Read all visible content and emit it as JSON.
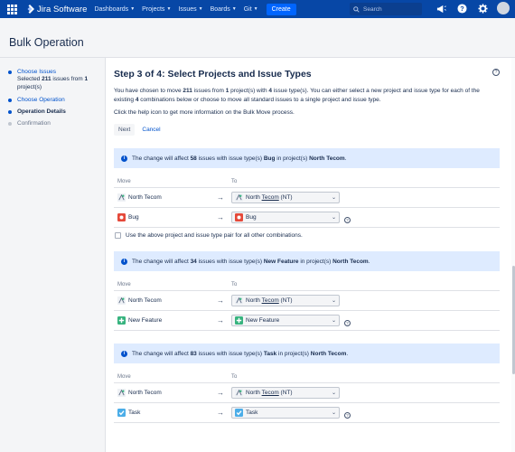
{
  "nav": {
    "product": "Jira Software",
    "menu": [
      "Dashboards",
      "Projects",
      "Issues",
      "Boards",
      "Git"
    ],
    "create_label": "Create",
    "search_placeholder": "Search"
  },
  "page": {
    "title": "Bulk Operation"
  },
  "sidebar": {
    "steps": [
      {
        "label": "Choose Issues",
        "detail_prefix": "Selected ",
        "detail_count": "211",
        "detail_mid": " issues from ",
        "detail_projects": "1",
        "detail_suffix": " project(s)"
      },
      {
        "label": "Choose Operation"
      },
      {
        "label": "Operation Details"
      },
      {
        "label": "Confirmation"
      }
    ]
  },
  "main": {
    "heading": "Step 3 of 4: Select Projects and Issue Types",
    "desc1_a": "You have chosen to move ",
    "desc1_count": "211",
    "desc1_b": " issues from ",
    "desc1_projects": "1",
    "desc1_c": " project(s) with ",
    "desc1_types": "4",
    "desc1_d": " issue type(s). You can either select a new project and issue type for each of the existing ",
    "desc1_combos": "4",
    "desc1_e": " combinations below or choose to move all standard issues to a single project and issue type.",
    "desc2": "Click the help icon to get more information on the Bulk Move process.",
    "next_label": "Next",
    "cancel_label": "Cancel",
    "col_move": "Move",
    "col_to": "To",
    "checkbox_label": "Use the above project and issue type pair for all other combinations.",
    "info_a": "The change will affect ",
    "info_b": " issues with issue type(s) ",
    "info_c": " in project(s) ",
    "groups": [
      {
        "count": "58",
        "type": "Bug",
        "project": "North Tecom",
        "from_project": "North Tecom",
        "to_project_a": "North ",
        "to_project_u": "Tecom",
        "to_project_b": " (NT)",
        "from_type": "Bug",
        "to_type": "Bug"
      },
      {
        "count": "34",
        "type": "New Feature",
        "project": "North Tecom",
        "from_project": "North Tecom",
        "to_project_a": "North ",
        "to_project_u": "Tecom",
        "to_project_b": " (NT)",
        "from_type": "New Feature",
        "to_type": "New Feature"
      },
      {
        "count": "83",
        "type": "Task",
        "project": "North Tecom",
        "from_project": "North Tecom",
        "to_project_a": "North ",
        "to_project_u": "Tecom",
        "to_project_b": " (NT)",
        "from_type": "Task",
        "to_type": "Task"
      }
    ]
  },
  "colors": {
    "nav_bg": "#0747a6",
    "create": "#0065ff",
    "info_bg": "#deebff",
    "bug": "#e5493a",
    "feature": "#36b37e",
    "task": "#4bade8"
  }
}
